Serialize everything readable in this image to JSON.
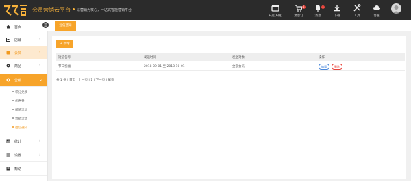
{
  "header": {
    "platform_name": "会员营销云平台",
    "slogan": "以营销为核心，一站式智能营销平台",
    "actions": [
      {
        "label": "开店(6期)",
        "icon": "store-icon"
      },
      {
        "label": "消息订",
        "icon": "cart-icon",
        "badge": "1"
      },
      {
        "label": "消息",
        "icon": "bell-icon",
        "badge": "1"
      },
      {
        "label": "下载",
        "icon": "download-icon"
      },
      {
        "label": "工具",
        "icon": "tools-icon"
      },
      {
        "label": "客服",
        "icon": "cloud-icon"
      }
    ]
  },
  "sidebar": {
    "items": [
      {
        "label": "首页",
        "icon": "home-icon"
      },
      {
        "label": "店铺",
        "icon": "shop-icon"
      },
      {
        "label": "会员",
        "icon": "member-icon"
      },
      {
        "label": "商品",
        "icon": "goods-icon"
      },
      {
        "label": "营销",
        "icon": "marketing-icon"
      }
    ],
    "marketing_sub": [
      "积分兑换",
      "优惠券",
      "储值活动",
      "营销活动",
      "短信通知"
    ],
    "bottom_items": [
      {
        "label": "统计",
        "icon": "chart-icon"
      },
      {
        "label": "设置",
        "icon": "list-icon"
      },
      {
        "label": "帮助",
        "icon": "help-icon"
      }
    ]
  },
  "tab": {
    "label": "短信通知"
  },
  "toolbar": {
    "add_label": "+ 新增"
  },
  "table": {
    "headers": [
      "短信名称",
      "发送时间",
      "发送对象",
      "操作"
    ],
    "rows": [
      {
        "name": "节日祝福",
        "time": "2018-09-01 至 2018-10-01",
        "target": "全部会员"
      }
    ],
    "actions": {
      "edit": "编辑",
      "delete": "删除"
    }
  },
  "pager": {
    "text": "共 1 条 | 首页 | 上一页 | 1 | 下一页 | 尾页"
  },
  "colors": {
    "accent": "#f7a42a",
    "topbar": "#2b2b2b",
    "edit": "#4b89dc",
    "delete": "#e8433a"
  }
}
